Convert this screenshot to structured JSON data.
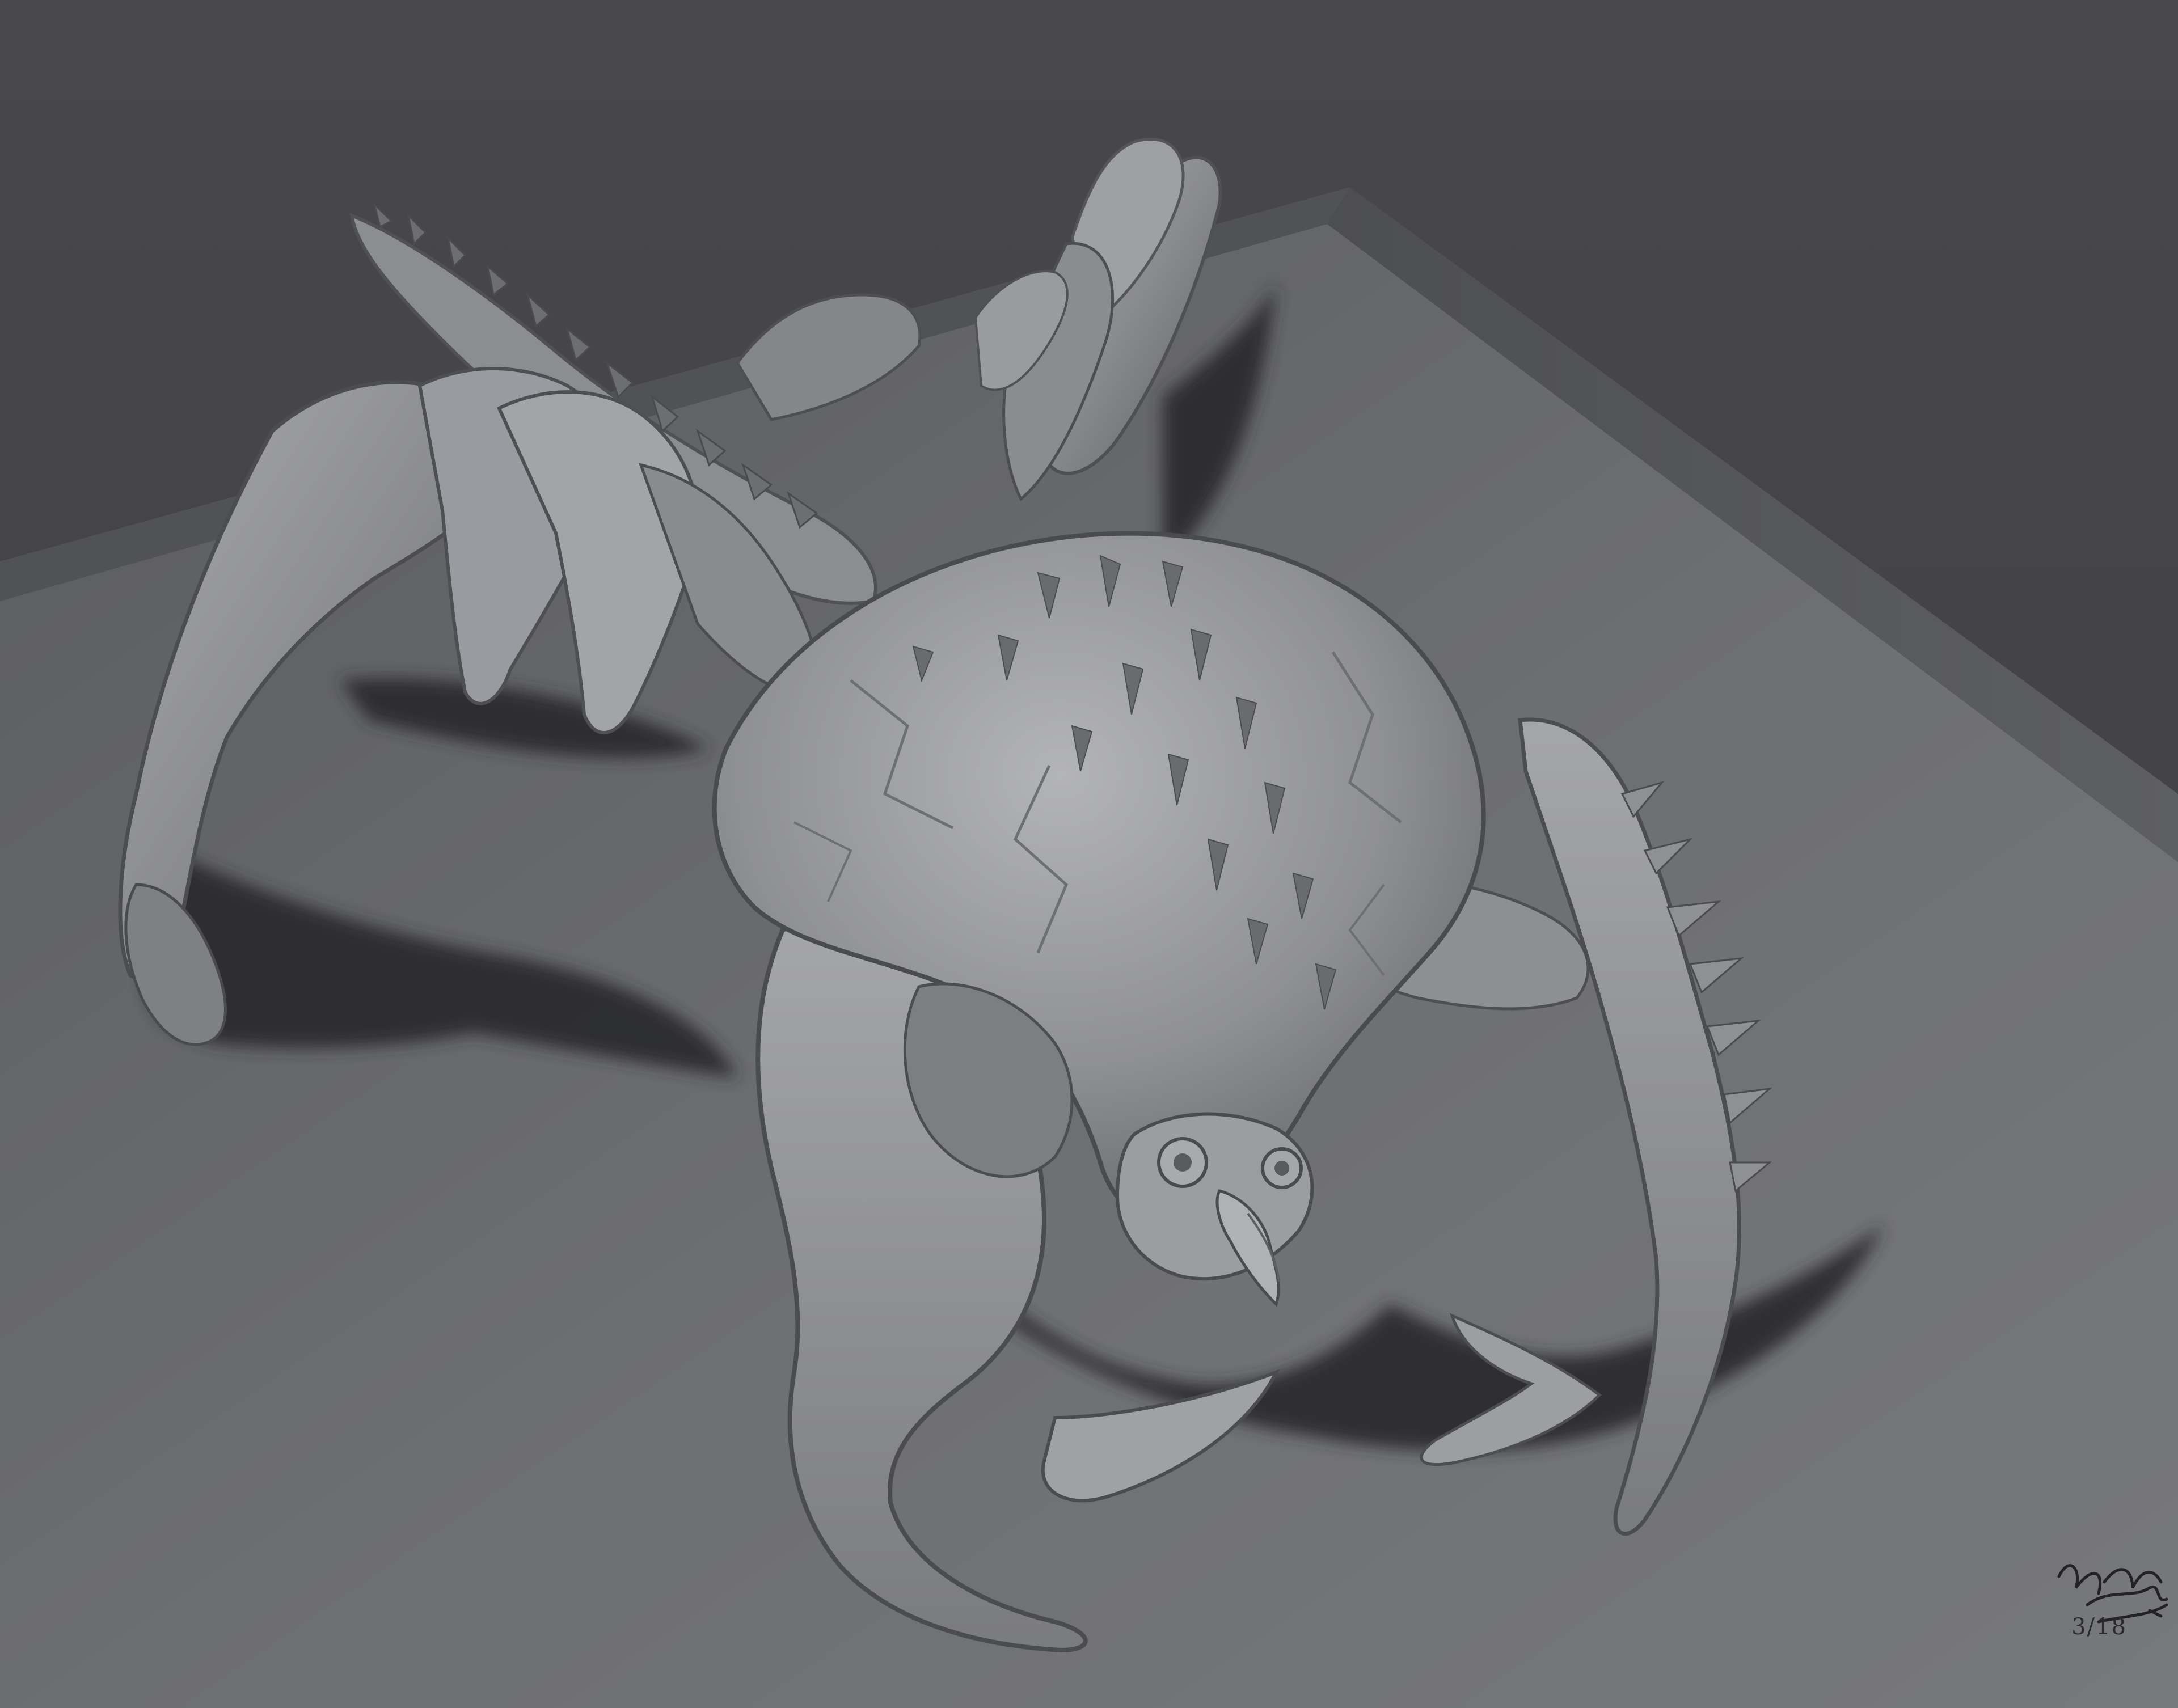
{
  "scene": {
    "background_color": "#464648",
    "platform_top_color": "#6f7073",
    "platform_edge_color": "#525356",
    "shadow_color": "#2a2a2c",
    "creature_color": "#8d8e92",
    "creature_highlight": "#b4b5b9",
    "creature_dark": "#5c5d61"
  },
  "signature": {
    "kind": "handwritten-signature",
    "date": "3/18"
  }
}
